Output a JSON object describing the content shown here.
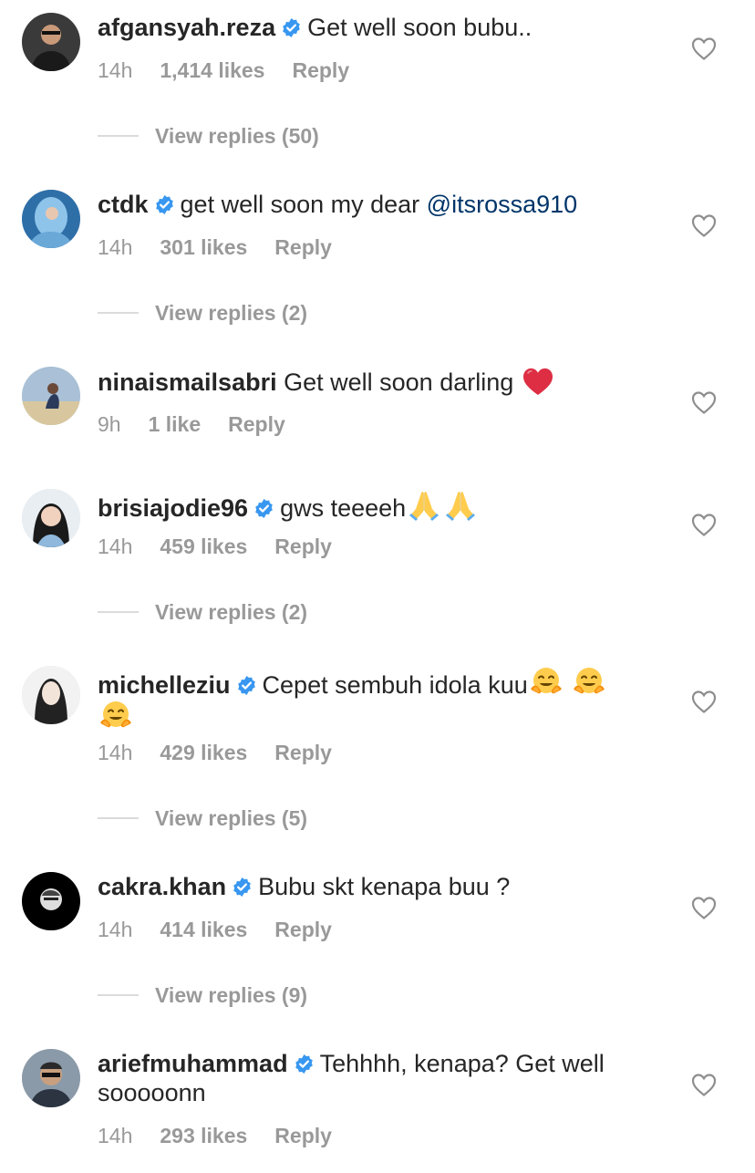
{
  "comments": [
    {
      "username": "afgansyah.reza",
      "verified": true,
      "text": "Get well soon bubu..",
      "time": "14h",
      "likes": "1,414 likes",
      "reply": "Reply",
      "view_replies": "View replies (50)"
    },
    {
      "username": "ctdk",
      "verified": true,
      "text": "get well soon my dear ",
      "mention": "@itsrossa910",
      "time": "14h",
      "likes": "301 likes",
      "reply": "Reply",
      "view_replies": "View replies (2)"
    },
    {
      "username": "ninaismailsabri",
      "verified": false,
      "text": "Get well soon darling ",
      "emoji": "red-heart",
      "time": "9h",
      "likes": "1 like",
      "reply": "Reply"
    },
    {
      "username": "brisiajodie96",
      "verified": true,
      "text": "gws teeeeh",
      "emoji": "folded-hands x2",
      "time": "14h",
      "likes": "459 likes",
      "reply": "Reply",
      "view_replies": "View replies (2)"
    },
    {
      "username": "michelleziu",
      "verified": true,
      "text": "Cepet sembuh idola kuu",
      "emoji": "hugging-face x3",
      "time": "14h",
      "likes": "429 likes",
      "reply": "Reply",
      "view_replies": "View replies (5)"
    },
    {
      "username": "cakra.khan",
      "verified": true,
      "text": "Bubu skt kenapa buu ?",
      "time": "14h",
      "likes": "414 likes",
      "reply": "Reply",
      "view_replies": "View replies (9)"
    },
    {
      "username": "ariefmuhammad",
      "verified": true,
      "text": "Tehhhh, kenapa? Get well sooooonn",
      "time": "14h",
      "likes": "293 likes",
      "reply": "Reply"
    }
  ],
  "colors": {
    "text": "#262626",
    "meta": "#999999",
    "verified": "#3897f0",
    "mention": "#003569",
    "heart_outline": "#8e8e8e"
  }
}
